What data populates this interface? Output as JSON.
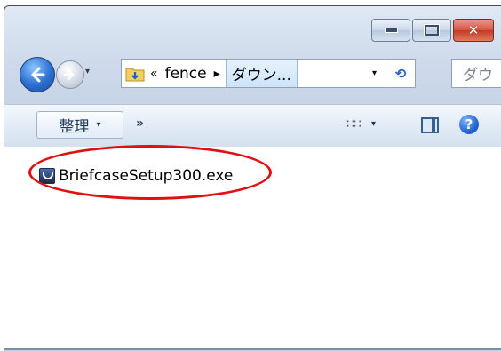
{
  "window": {
    "caption_buttons": {
      "minimize_icon": "minimize-icon",
      "maximize_icon": "maximize-icon",
      "close_icon": "close-icon",
      "close_glyph": "✕",
      "close_color": "#c43a24"
    }
  },
  "navigation": {
    "back_icon": "back-arrow-icon",
    "forward_icon": "forward-arrow-icon",
    "history_dropdown": "▾"
  },
  "address_bar": {
    "overflow_marker": "«",
    "crumbs": [
      "fence",
      "ダウン..."
    ],
    "separator": "▸",
    "dropdown": "▾",
    "refresh_icon": "⟲"
  },
  "search": {
    "placeholder": "ダウ"
  },
  "command_bar": {
    "organize_label": "整理",
    "organize_arrow": "▾",
    "more_label": "»",
    "views_icon": "∷∷",
    "views_arrow": "▾",
    "help_label": "?"
  },
  "files": [
    {
      "name": "BriefcaseSetup300.exe",
      "icon": "exe-icon"
    }
  ],
  "annotation": {
    "type": "ellipse",
    "color": "#e01010"
  }
}
